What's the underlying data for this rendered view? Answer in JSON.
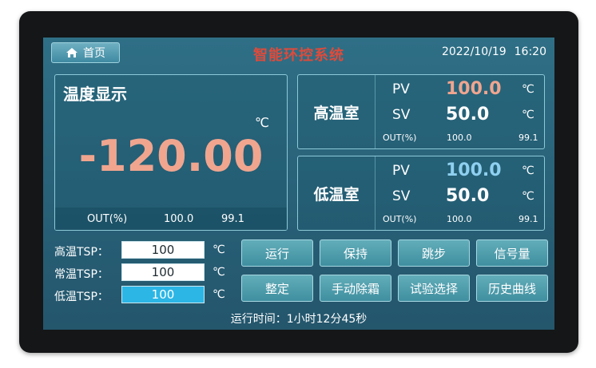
{
  "header": {
    "home_label": "首页",
    "home_icon": "home-icon",
    "system_title": "智能环控系统",
    "date": "2022/10/19",
    "time": "16:20"
  },
  "temperature_panel": {
    "title": "温度显示",
    "unit": "℃",
    "value": "-120.00",
    "out_label": "OUT(%)",
    "out_value1": "100.0",
    "out_value2": "99.1"
  },
  "chambers": {
    "high": {
      "name": "高温室",
      "pv_label": "PV",
      "pv_value": "100.0",
      "pv_unit": "℃",
      "sv_label": "SV",
      "sv_value": "50.0",
      "sv_unit": "℃",
      "out_label": "OUT(%)",
      "out_value1": "100.0",
      "out_value2": "99.1"
    },
    "low": {
      "name": "低温室",
      "pv_label": "PV",
      "pv_value": "100.0",
      "pv_unit": "℃",
      "sv_label": "SV",
      "sv_value": "50.0",
      "sv_unit": "℃",
      "out_label": "OUT(%)",
      "out_value1": "100.0",
      "out_value2": "99.1"
    }
  },
  "tsp": [
    {
      "label": "高温TSP：",
      "value": "100",
      "unit": "℃"
    },
    {
      "label": "常温TSP：",
      "value": "100",
      "unit": "℃"
    },
    {
      "label": "低温TSP：",
      "value": "100",
      "unit": "℃"
    }
  ],
  "buttons": {
    "run": "运行",
    "hold": "保持",
    "skip": "跳步",
    "signal": "信号量",
    "tune": "整定",
    "manual_defrost": "手动除霜",
    "test_select": "试验选择",
    "history_curve": "历史曲线"
  },
  "status": {
    "runtime": "运行时间：1小时12分45秒"
  },
  "colors": {
    "screen_bg": "#2a667d",
    "title_red": "#e04a3a",
    "pv_high": "#f0a58f",
    "pv_low": "#8fd0f0",
    "active_input": "#2bb6e6"
  }
}
